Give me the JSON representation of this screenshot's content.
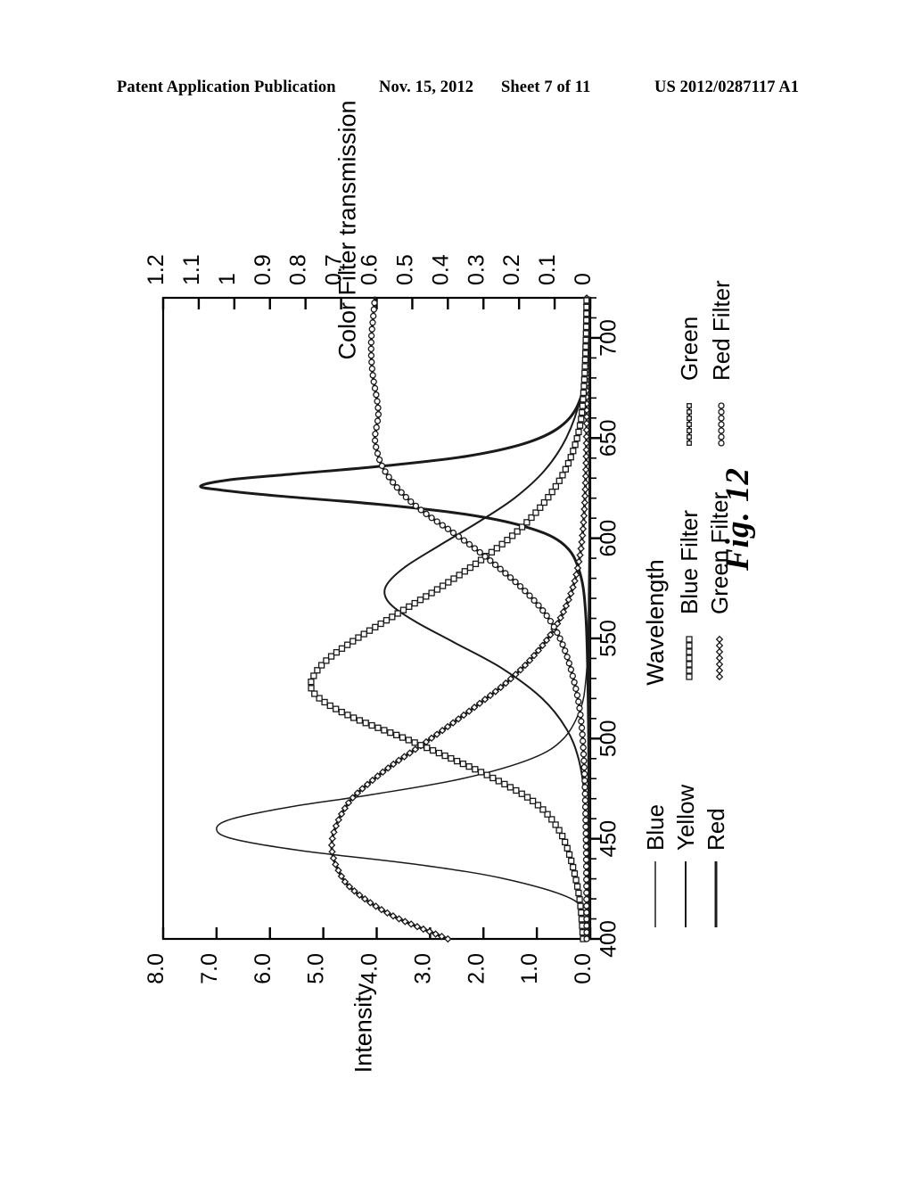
{
  "header": {
    "publication": "Patent Application Publication",
    "date": "Nov. 15, 2012",
    "sheet": "Sheet 7 of 11",
    "number": "US 2012/0287117 A1"
  },
  "figure": {
    "caption": "Fig. 12"
  },
  "chart_data": {
    "type": "line",
    "title": "",
    "orientation": "rotated-90-ccw",
    "xlabel": "Wavelength",
    "ylabel": "Intensity",
    "secondary_ylabel": "Color Filter transmission",
    "xlim": [
      400,
      720
    ],
    "ylim": [
      0.0,
      8.0
    ],
    "secondary_ylim": [
      0,
      1.2
    ],
    "grid": false,
    "legend_position": "right-outside",
    "x_tick_labels": [
      "400",
      "450",
      "500",
      "550",
      "600",
      "650",
      "700"
    ],
    "x_ticks": [
      400,
      450,
      500,
      550,
      600,
      650,
      700
    ],
    "y_tick_labels": [
      "8.0",
      "7.0",
      "6.0",
      "5.0",
      "4.0",
      "3.0",
      "2.0",
      "1.0",
      "0.0"
    ],
    "y_ticks": [
      8.0,
      7.0,
      6.0,
      5.0,
      4.0,
      3.0,
      2.0,
      1.0,
      0.0
    ],
    "secondary_tick_labels": [
      "1.2",
      "1.1",
      "1",
      "0.9",
      "0.8",
      "0.7",
      "0.6",
      "0.5",
      "0.4",
      "0.3",
      "0.2",
      "0.1",
      "0"
    ],
    "secondary_ticks": [
      1.2,
      1.1,
      1.0,
      0.9,
      0.8,
      0.7,
      0.6,
      0.5,
      0.4,
      0.3,
      0.2,
      0.1,
      0
    ],
    "legend_groups": [
      {
        "entries": [
          {
            "label": "Blue",
            "marker": "none",
            "line": "thin"
          },
          {
            "label": "Yellow",
            "marker": "none",
            "line": "medium"
          },
          {
            "label": "Red",
            "marker": "none",
            "line": "thick"
          }
        ]
      },
      {
        "entries": [
          {
            "label": "Blue Filter",
            "marker": "square",
            "line": "marker"
          },
          {
            "label": "Green Filter",
            "marker": "diamond",
            "line": "marker"
          }
        ]
      },
      {
        "entries": [
          {
            "label": "Green",
            "marker": "square-small",
            "line": "marker"
          },
          {
            "label": "Red Filter",
            "marker": "circle",
            "line": "marker"
          }
        ]
      }
    ],
    "series": [
      {
        "name": "Blue",
        "axis": "intensity",
        "marker": "none",
        "stroke": "thin",
        "peak_x": 455,
        "peak_y": 7.0,
        "fwhm": 42,
        "points_x": [
          400,
          410,
          420,
          430,
          437,
          444,
          450,
          455,
          460,
          466,
          472,
          480,
          490,
          500,
          515,
          530,
          550,
          575,
          600,
          630,
          660,
          700,
          720
        ],
        "points_y": [
          0.05,
          0.12,
          0.35,
          1.6,
          3.2,
          5.4,
          6.7,
          7.0,
          6.7,
          5.6,
          4.1,
          2.4,
          1.1,
          0.5,
          0.18,
          0.08,
          0.04,
          0.03,
          0.02,
          0.02,
          0.02,
          0.02,
          0.02
        ]
      },
      {
        "name": "Yellow",
        "axis": "intensity",
        "marker": "none",
        "stroke": "medium",
        "peak_x": 572,
        "peak_y": 3.85,
        "fwhm": 70,
        "points_x": [
          400,
          440,
          470,
          490,
          505,
          520,
          535,
          548,
          558,
          566,
          572,
          578,
          586,
          596,
          608,
          620,
          634,
          650,
          670,
          690,
          710,
          720
        ],
        "points_y": [
          0.02,
          0.04,
          0.1,
          0.22,
          0.45,
          0.9,
          1.65,
          2.55,
          3.25,
          3.7,
          3.85,
          3.78,
          3.45,
          2.85,
          2.1,
          1.42,
          0.85,
          0.45,
          0.18,
          0.07,
          0.03,
          0.02
        ]
      },
      {
        "name": "Red",
        "axis": "intensity",
        "marker": "none",
        "stroke": "thick",
        "peak_x": 626,
        "peak_y": 7.3,
        "fwhm": 26,
        "points_x": [
          400,
          500,
          560,
          585,
          598,
          606,
          612,
          617,
          621,
          624,
          626,
          629,
          632,
          636,
          641,
          648,
          657,
          670,
          690,
          710,
          720
        ],
        "points_y": [
          0.02,
          0.03,
          0.08,
          0.22,
          0.55,
          1.25,
          2.35,
          4.0,
          5.8,
          6.9,
          7.3,
          6.8,
          5.6,
          3.9,
          2.3,
          1.15,
          0.5,
          0.18,
          0.06,
          0.03,
          0.02
        ]
      },
      {
        "name": "Blue Filter",
        "axis": "transmission",
        "marker": "diamond",
        "stroke": "thick",
        "peak_x": 455,
        "peak_y": 0.72,
        "points_x": [
          400,
          412,
          425,
          435,
          443,
          450,
          456,
          462,
          470,
          478,
          487,
          496,
          506,
          517,
          528,
          540,
          555,
          572,
          590,
          610,
          635,
          660,
          690,
          720
        ],
        "points_y": [
          0.4,
          0.56,
          0.67,
          0.71,
          0.725,
          0.725,
          0.715,
          0.7,
          0.67,
          0.62,
          0.555,
          0.48,
          0.4,
          0.315,
          0.235,
          0.165,
          0.1,
          0.055,
          0.03,
          0.018,
          0.012,
          0.01,
          0.01,
          0.01
        ]
      },
      {
        "name": "Green Filter",
        "axis": "transmission",
        "marker": "square",
        "stroke": "thick",
        "peak_x": 525,
        "peak_y": 0.79,
        "points_x": [
          400,
          420,
          440,
          455,
          468,
          480,
          490,
          500,
          510,
          518,
          525,
          532,
          540,
          550,
          562,
          575,
          590,
          605,
          620,
          636,
          655,
          675,
          700,
          720
        ],
        "points_y": [
          0.02,
          0.03,
          0.055,
          0.09,
          0.155,
          0.27,
          0.39,
          0.52,
          0.66,
          0.745,
          0.785,
          0.775,
          0.735,
          0.655,
          0.545,
          0.425,
          0.3,
          0.195,
          0.12,
          0.065,
          0.03,
          0.018,
          0.012,
          0.01
        ]
      },
      {
        "name": "Red Filter",
        "axis": "transmission",
        "marker": "circle",
        "stroke": "thick",
        "peak_x": 700,
        "peak_y": 0.61,
        "points_x": [
          400,
          450,
          490,
          515,
          535,
          550,
          562,
          574,
          585,
          595,
          604,
          612,
          620,
          628,
          636,
          644,
          650,
          656,
          662,
          670,
          680,
          690,
          700,
          710,
          720
        ],
        "points_y": [
          0.01,
          0.012,
          0.018,
          0.03,
          0.055,
          0.085,
          0.125,
          0.185,
          0.255,
          0.325,
          0.395,
          0.46,
          0.515,
          0.555,
          0.585,
          0.6,
          0.605,
          0.6,
          0.595,
          0.6,
          0.61,
          0.615,
          0.615,
          0.61,
          0.605
        ]
      }
    ]
  }
}
